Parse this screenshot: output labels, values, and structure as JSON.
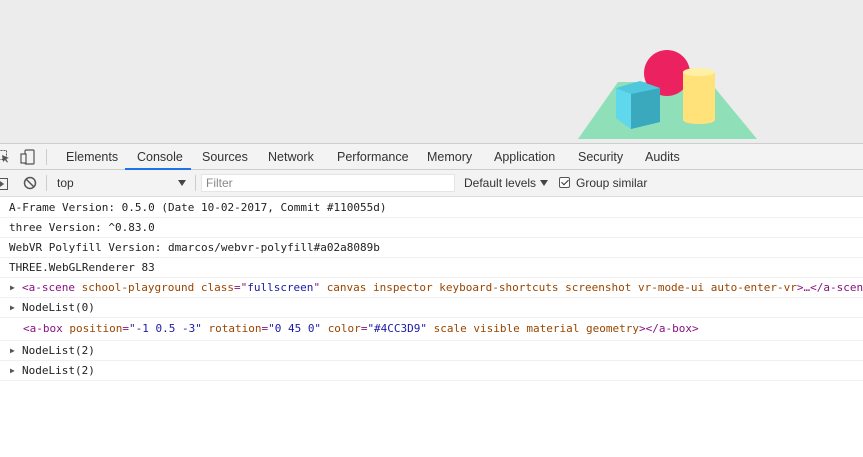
{
  "tabs": [
    "Elements",
    "Console",
    "Sources",
    "Network",
    "Performance",
    "Memory",
    "Application",
    "Security",
    "Audits"
  ],
  "toolbar": {
    "context": "top",
    "filter_placeholder": "Filter",
    "levels": "Default levels",
    "group_label": "Group similar",
    "group_checked": true
  },
  "console": {
    "line1": "A-Frame Version: 0.5.0 (Date 10-02-2017, Commit #110055d)",
    "line2": "three Version: ^0.83.0",
    "line3": "WebVR Polyfill Version: dmarcos/webvr-polyfill#a02a8089b",
    "line4": "THREE.WebGLRenderer 83",
    "scene": {
      "open": "<a-scene",
      "school_attr": "school-playground",
      "class_attr": "class",
      "eq1": "=\"",
      "class_val": "fullscreen",
      "q1": "\"",
      "rest_attrs": "canvas inspector keyboard-shortcuts screenshot vr-mode-ui auto-enter-vr",
      "close": ">…</a-scene>"
    },
    "nodelist0": "NodeList(0)",
    "box": {
      "open": "<a-box",
      "pos_attr": "position",
      "pos_val": "\"-1 0.5 -3\"",
      "rot_attr": "rotation",
      "rot_val": "\"0 45 0\"",
      "color_attr": "color",
      "color_val": "\"#4CC3D9\"",
      "rest_attrs": "scale visible material geometry",
      "close": "></a-box>"
    },
    "nodelist2a": "NodeList(2)",
    "nodelist2b": "NodeList(2)"
  },
  "colors": {
    "sphere": "#EF2D5E",
    "box": "#4CC3D9",
    "cylinder": "#FFC65D",
    "plane": "#7BC8A4",
    "accent": "#1a73e8"
  }
}
